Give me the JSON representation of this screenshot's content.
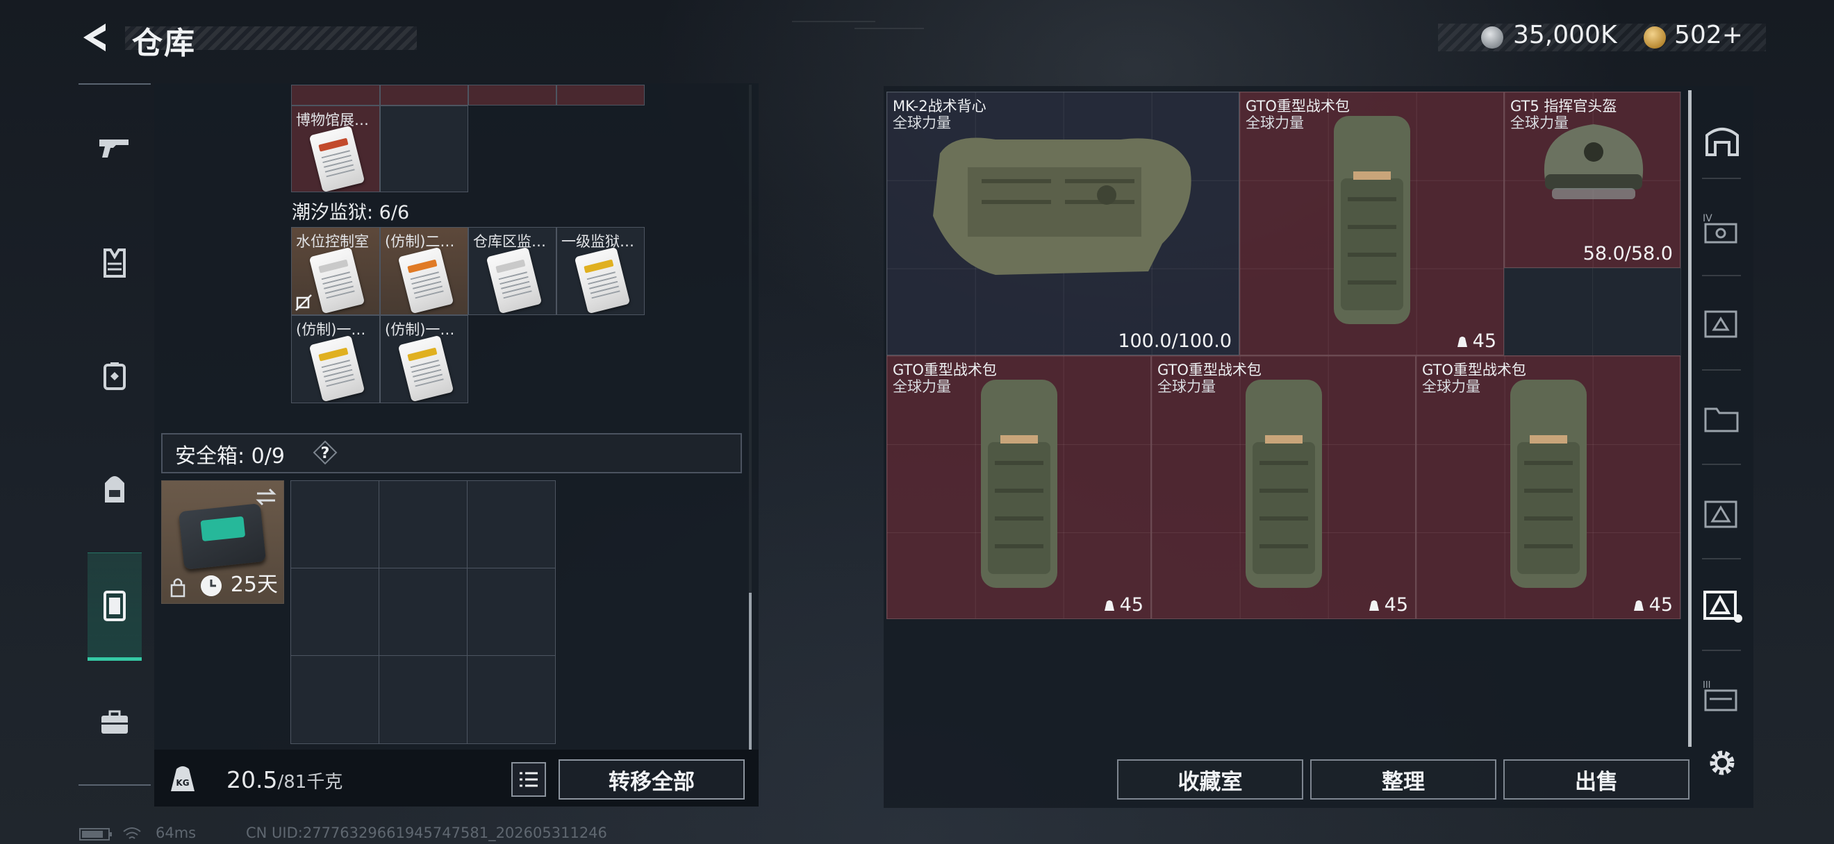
{
  "header": {
    "title": "仓库",
    "currency_silver": "35,000K",
    "currency_gold": "502+"
  },
  "left_nav": {
    "items": [
      "gun-icon",
      "armor-icon",
      "vest-icon",
      "backpack-icon",
      "safebox-icon",
      "toolbox-icon"
    ],
    "active": "safebox-icon"
  },
  "inventory": {
    "museum_card_label": "博物馆展…",
    "prison_section": "潮汐监狱: 6/6",
    "prison_cards": [
      {
        "label": "水位控制室",
        "stripe": "#c9c9c9",
        "no_transfer": true
      },
      {
        "label": "(仿制)二…",
        "stripe": "#e07a25",
        "no_transfer": false
      },
      {
        "label": "仓库区监…",
        "stripe": "#c9c9c9",
        "no_transfer": false
      },
      {
        "label": "一级监狱…",
        "stripe": "#e0b020",
        "no_transfer": false
      },
      {
        "label": "(仿制)一…",
        "stripe": "#e0b020",
        "no_transfer": false
      },
      {
        "label": "(仿制)一…",
        "stripe": "#e0b020",
        "no_transfer": false
      }
    ],
    "safebox_label": "安全箱: 0/9",
    "safebox_help": "?",
    "safe_case_days": "25天",
    "weight_current": "20.5",
    "weight_max": "/81千克",
    "transfer_all": "转移全部"
  },
  "stash": {
    "items": [
      {
        "name": "MK-2战术背心",
        "sub": "全球力量",
        "stat": "100.0/100.0",
        "kind": "vest"
      },
      {
        "name": "GTO重型战术包",
        "sub": "全球力量",
        "stat": "45",
        "kind": "backpack"
      },
      {
        "name": "GT5 指挥官头盔",
        "sub": "全球力量",
        "stat": "58.0/58.0",
        "kind": "helmet"
      },
      {
        "name": "GTO重型战术包",
        "sub": "全球力量",
        "stat": "45",
        "kind": "backpack"
      },
      {
        "name": "GTO重型战术包",
        "sub": "全球力量",
        "stat": "45",
        "kind": "backpack"
      },
      {
        "name": "GTO重型战术包",
        "sub": "全球力量",
        "stat": "45",
        "kind": "backpack"
      }
    ],
    "buttons": {
      "collection": "收藏室",
      "organize": "整理",
      "sell": "出售"
    }
  },
  "right_nav": {
    "items": [
      "stash-1-icon",
      "stash-4-icon",
      "stash-2-icon",
      "stash-folder-icon",
      "stash-3-icon",
      "stash-active-icon",
      "stash-lv3-icon"
    ],
    "settings": "gear-icon",
    "roman_4": "IV",
    "roman_3": "III"
  },
  "status": {
    "ping": "64ms",
    "uid": "CN UID:27776329661945747581_202605311246"
  },
  "colors": {
    "accent": "#35c9a5",
    "locked_red": "#6e2832"
  }
}
